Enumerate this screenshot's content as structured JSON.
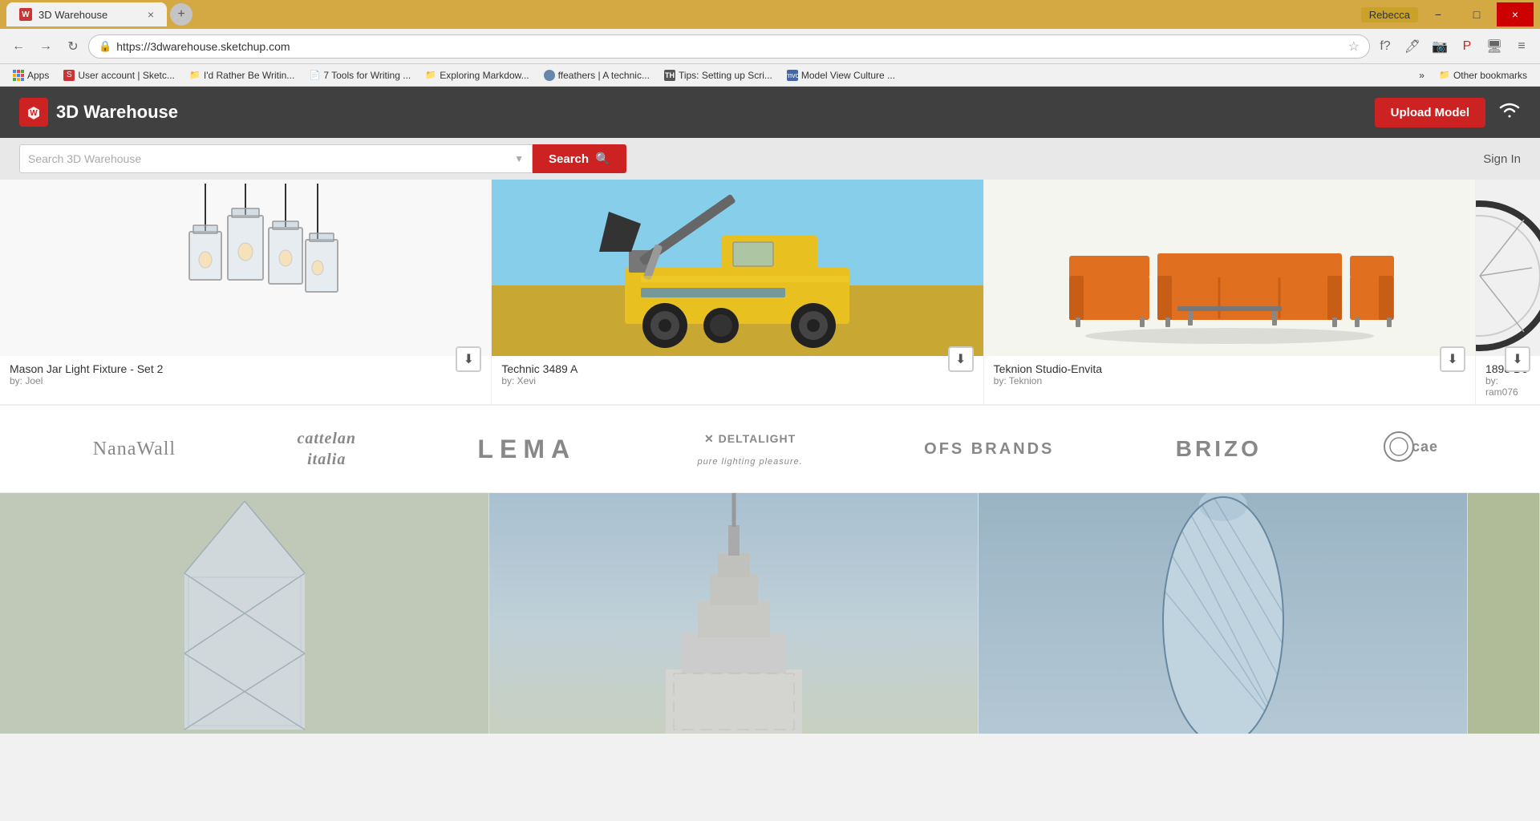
{
  "browser": {
    "tab_title": "3D Warehouse",
    "url": "https://3dwarehouse.sketchup.com",
    "user": "Rebecca",
    "new_tab_label": "+",
    "window_controls": {
      "minimize": "−",
      "maximize": "□",
      "close": "×"
    }
  },
  "bookmarks": {
    "items": [
      {
        "id": "apps",
        "label": "Apps",
        "type": "apps"
      },
      {
        "id": "user-account",
        "label": "User account | Sketc...",
        "type": "favicon",
        "color": "#cc3333"
      },
      {
        "id": "rather-be-writing",
        "label": "I'd Rather Be Writin...",
        "type": "folder"
      },
      {
        "id": "7-tools",
        "label": "7 Tools for Writing ...",
        "type": "page"
      },
      {
        "id": "exploring-markdown",
        "label": "Exploring Markdow...",
        "type": "folder"
      },
      {
        "id": "ffeathers",
        "label": "ffeathers | A technic...",
        "type": "avatar"
      },
      {
        "id": "tips-setting-up",
        "label": "Tips: Setting up Scri...",
        "type": "text",
        "text": "TH"
      },
      {
        "id": "mvc",
        "label": "Model View Culture ...",
        "type": "text",
        "text": "mvc"
      },
      {
        "id": "more",
        "label": "»",
        "type": "more"
      },
      {
        "id": "other-bookmarks",
        "label": "Other bookmarks",
        "type": "folder"
      }
    ]
  },
  "site": {
    "header": {
      "logo_text": "3D Warehouse",
      "upload_btn": "Upload Model",
      "logo_letter": "W"
    },
    "search": {
      "placeholder": "Search 3D Warehouse",
      "button_label": "Search",
      "sign_in": "Sign In"
    },
    "models": [
      {
        "id": "mason-jar",
        "name": "Mason Jar Light Fixture - Set 2",
        "author": "by: Joel"
      },
      {
        "id": "technic",
        "name": "Technic 3489 A",
        "author": "by: Xevi"
      },
      {
        "id": "teknion",
        "name": "Teknion Studio-Envita",
        "author": "by: Teknion"
      },
      {
        "id": "partial",
        "name": "1898 De",
        "author": "by: ram076"
      }
    ],
    "brands": [
      {
        "id": "nanawall",
        "label": "NanaWall",
        "class": "nanawall"
      },
      {
        "id": "cattelan-italia",
        "label": "cattelan\nitalia",
        "class": "cattelan"
      },
      {
        "id": "lema",
        "label": "LEMA",
        "class": "lema"
      },
      {
        "id": "deltalight",
        "label": "✕ DELTALIGHT\npure lighting pleasure.",
        "class": "delta"
      },
      {
        "id": "ofs-brands",
        "label": "OFS BRANDS",
        "class": "ofs"
      },
      {
        "id": "brizo",
        "label": "BRIZO",
        "class": "brizo"
      },
      {
        "id": "cae",
        "label": "◎ cae",
        "class": "cae"
      }
    ],
    "buildings": [
      {
        "id": "boc-tower",
        "style": "building1"
      },
      {
        "id": "empire-state",
        "style": "building2"
      },
      {
        "id": "gherkin",
        "style": "building3"
      },
      {
        "id": "partial-bldg",
        "style": "building4"
      }
    ]
  }
}
